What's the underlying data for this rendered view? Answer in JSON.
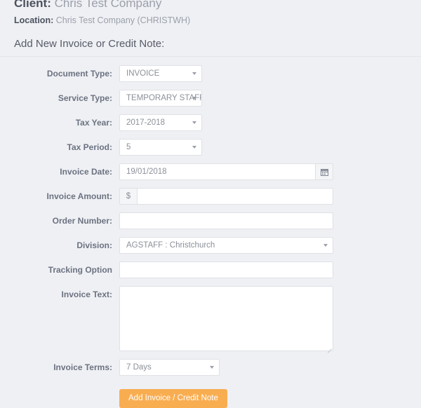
{
  "header": {
    "client_label": "Client:",
    "client_value": "Chris Test Company",
    "location_label": "Location:",
    "location_value": "Chris Test Company (CHRISTWH)",
    "section_heading": "Add New Invoice or Credit Note:"
  },
  "form": {
    "document_type": {
      "label": "Document Type:",
      "value": "INVOICE"
    },
    "service_type": {
      "label": "Service Type:",
      "value": "TEMPORARY STAFF"
    },
    "tax_year": {
      "label": "Tax Year:",
      "value": "2017-2018"
    },
    "tax_period": {
      "label": "Tax Period:",
      "value": "5"
    },
    "invoice_date": {
      "label": "Invoice Date:",
      "value": "19/01/2018",
      "icon": "calendar-icon"
    },
    "invoice_amount": {
      "label": "Invoice Amount:",
      "prefix": "$",
      "value": ""
    },
    "order_number": {
      "label": "Order Number:",
      "value": ""
    },
    "division": {
      "label": "Division:",
      "value": "AGSTAFF : Christchurch"
    },
    "tracking_option": {
      "label": "Tracking Option",
      "value": ""
    },
    "invoice_text": {
      "label": "Invoice Text:",
      "value": ""
    },
    "invoice_terms": {
      "label": "Invoice Terms:",
      "value": "7 Days"
    },
    "submit_label": "Add Invoice / Credit Note"
  },
  "colors": {
    "page_background": "#eff0f4",
    "accent_button": "#f9ad51",
    "field_border": "#dfe1e6",
    "label_text": "#6b7280",
    "value_text": "#8b9099"
  }
}
